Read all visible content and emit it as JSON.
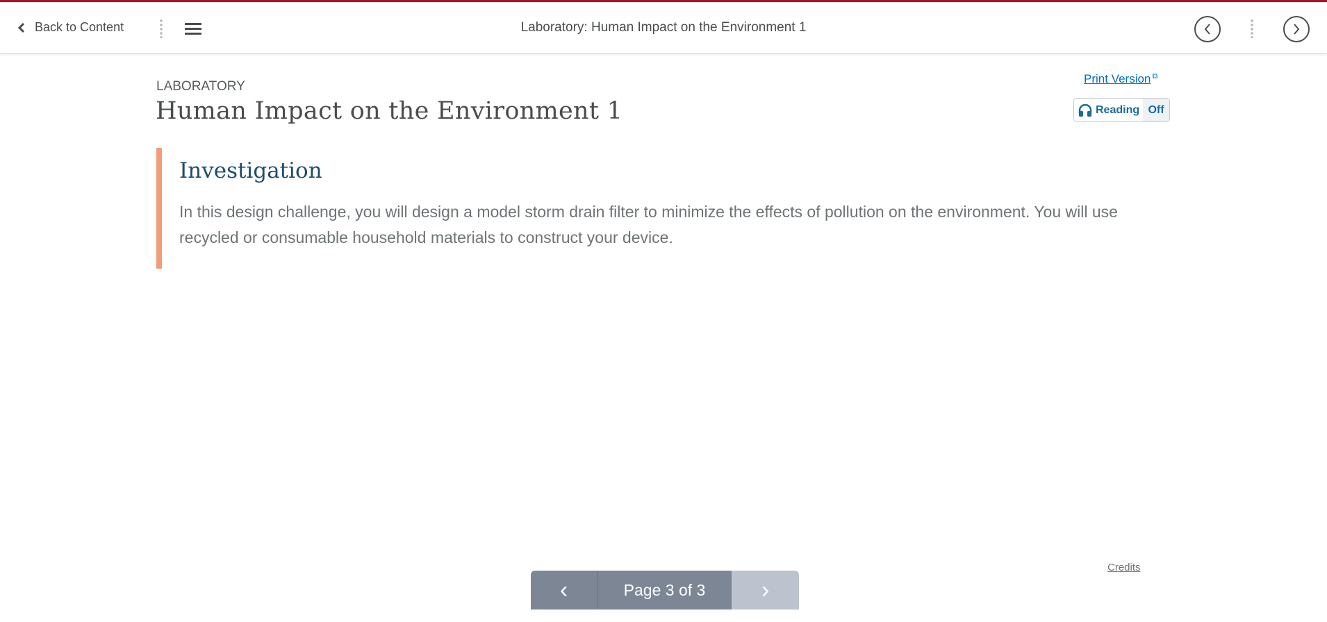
{
  "header": {
    "back_label": "Back to Content",
    "title": "Laboratory: Human Impact on the Environment 1",
    "prev_icon": "‹",
    "next_icon": "›"
  },
  "page": {
    "category": "LABORATORY",
    "title": "Human Impact on the Environment 1",
    "print_label": "Print Version",
    "reading_label": "Reading",
    "reading_state": "Off"
  },
  "section": {
    "heading": "Investigation",
    "text": "In this design challenge, you will design a model storm drain filter to minimize the effects of pollution on the environment. You will use recycled or consumable household materials to construct your device."
  },
  "pager": {
    "label": "Page 3 of 3",
    "prev": "‹",
    "next": "›"
  },
  "footer": {
    "credits": "Credits"
  },
  "colors": {
    "accent": "#b0122c",
    "bar": "#f39c7c",
    "link": "#006fbf"
  }
}
